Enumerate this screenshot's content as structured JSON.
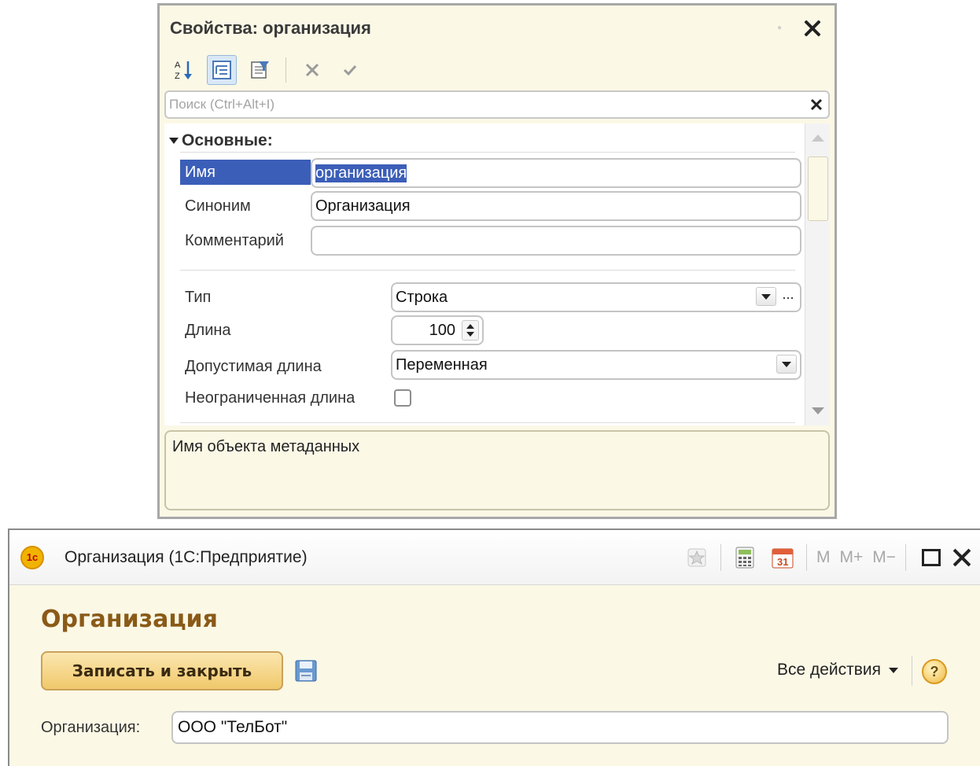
{
  "properties": {
    "title": "Свойства: организация",
    "search_placeholder": "Поиск (Ctrl+Alt+I)",
    "group_label": "Основные:",
    "fields": {
      "name_label": "Имя",
      "name_value": "организация",
      "synonym_label": "Синоним",
      "synonym_value": "Организация",
      "comment_label": "Комментарий",
      "comment_value": "",
      "type_label": "Тип",
      "type_value": "Строка",
      "length_label": "Длина",
      "length_value": "100",
      "allowed_length_label": "Допустимая длина",
      "allowed_length_value": "Переменная",
      "unlimited_label": "Неограниченная длина",
      "unlimited_checked": false,
      "dots": "..."
    },
    "description": "Имя объекта метаданных",
    "toolbar_icons": [
      "sort-az-icon",
      "group-icon",
      "filter-icon",
      "cancel-icon",
      "apply-icon"
    ]
  },
  "form": {
    "window_title": "Организация  (1С:Предприятие)",
    "logo_text": "1с",
    "heading": "Организация",
    "save_close_label": "Записать и закрыть",
    "all_actions_label": "Все действия",
    "help_label": "?",
    "org_label": "Организация:",
    "org_value": "ООО \"ТелБот\"",
    "mem_buttons": [
      "M",
      "M+",
      "M−"
    ],
    "calendar_day": "31"
  },
  "colors": {
    "panel_bg": "#FBF8E6",
    "selection": "#3b5eb8",
    "heading": "#8a5a17",
    "button": "#f0c86b"
  }
}
